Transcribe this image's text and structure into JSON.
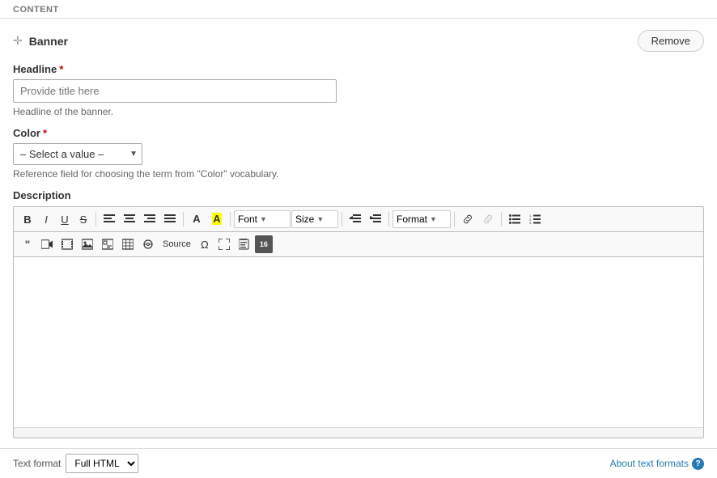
{
  "content_label": "CONTENT",
  "banner": {
    "title": "Banner",
    "remove_btn": "Remove",
    "headline": {
      "label": "Headline",
      "required": true,
      "placeholder": "Provide title here",
      "hint": "Headline of the banner."
    },
    "color": {
      "label": "Color",
      "required": true,
      "select_default": "– Select a value –",
      "hint": "Reference field for choosing the term from \"Color\" vocabulary."
    },
    "description": {
      "label": "Description"
    }
  },
  "toolbar": {
    "bold": "B",
    "italic": "I",
    "underline": "U",
    "strikethrough": "S",
    "align_left": "≡",
    "align_center": "≡",
    "align_right": "≡",
    "justify": "≡",
    "font_label": "Font",
    "size_label": "Size",
    "format_label": "Format",
    "source_label": "Source"
  },
  "text_format": {
    "label": "Text format",
    "value": "Full HTML",
    "about_link": "About text formats"
  }
}
